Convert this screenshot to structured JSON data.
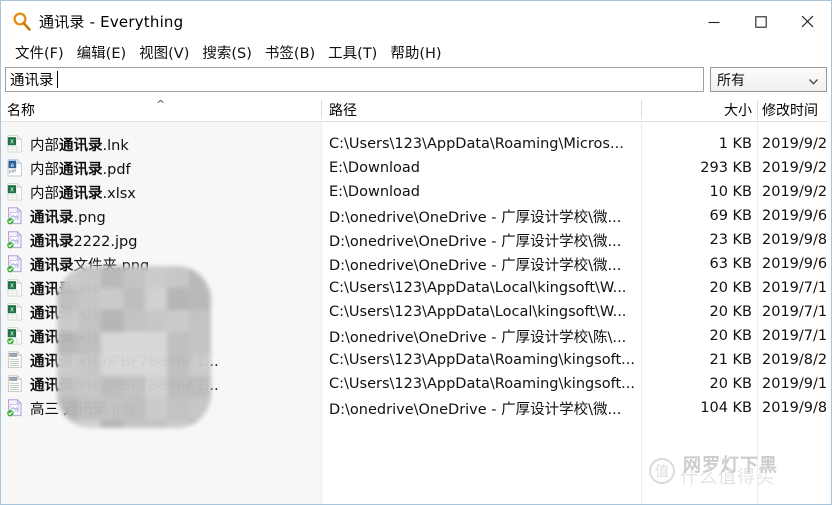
{
  "window": {
    "title": "通讯录 - Everything",
    "app_icon": "magnifier-icon",
    "controls": {
      "minimize": "—",
      "maximize": "□",
      "close": "✕"
    }
  },
  "menubar": {
    "items": [
      {
        "label": "文件(F)",
        "text": "文件(",
        "accel": "F",
        "tail": ")"
      },
      {
        "label": "编辑(E)",
        "text": "编辑(",
        "accel": "E",
        "tail": ")"
      },
      {
        "label": "视图(V)",
        "text": "视图(",
        "accel": "V",
        "tail": ")"
      },
      {
        "label": "搜索(S)",
        "text": "搜索(",
        "accel": "S",
        "tail": ")"
      },
      {
        "label": "书签(B)",
        "text": "书签(",
        "accel": "B",
        "tail": ")"
      },
      {
        "label": "工具(T)",
        "text": "工具(",
        "accel": "T",
        "tail": ")"
      },
      {
        "label": "帮助(H)",
        "text": "帮助(",
        "accel": "H",
        "tail": ")"
      }
    ]
  },
  "search": {
    "value": "通讯录",
    "placeholder": "",
    "filter_selected": "所有",
    "filter_icon": "chevron-down-icon"
  },
  "columns": [
    {
      "key": "name",
      "label": "名称",
      "sort": "asc",
      "sort_icon": "sort-ascending-icon"
    },
    {
      "key": "path",
      "label": "路径"
    },
    {
      "key": "size",
      "label": "大小"
    },
    {
      "key": "date",
      "label": "修改时间"
    }
  ],
  "rows": [
    {
      "icon": "excel-file-icon",
      "sync": false,
      "name_pre": "内部",
      "name_match": "通讯录",
      "name_post": ".lnk",
      "path": "C:\\Users\\123\\AppData\\Roaming\\Micros...",
      "size": "1 KB",
      "date": "2019/9/2"
    },
    {
      "icon": "pdf-file-icon",
      "sync": false,
      "name_pre": "内部",
      "name_match": "通讯录",
      "name_post": ".pdf",
      "path": "E:\\Download",
      "size": "293 KB",
      "date": "2019/9/2"
    },
    {
      "icon": "excel-file-icon",
      "sync": false,
      "name_pre": "内部",
      "name_match": "通讯录",
      "name_post": ".xlsx",
      "path": "E:\\Download",
      "size": "10 KB",
      "date": "2019/9/2"
    },
    {
      "icon": "image-file-icon",
      "sync": true,
      "name_pre": "",
      "name_match": "通讯录",
      "name_post": ".png",
      "path": "D:\\onedrive\\OneDrive - 广厚设计学校\\微...",
      "size": "69 KB",
      "date": "2019/9/6"
    },
    {
      "icon": "image-file-icon",
      "sync": true,
      "name_pre": "",
      "name_match": "通讯录",
      "name_post": "2222.jpg",
      "path": "D:\\onedrive\\OneDrive - 广厚设计学校\\微...",
      "size": "23 KB",
      "date": "2019/9/8"
    },
    {
      "icon": "image-file-icon",
      "sync": true,
      "name_pre": "",
      "name_match": "通讯录",
      "name_post": "文件夹.png",
      "path": "D:\\onedrive\\OneDrive - 广厚设计学校\\微...",
      "size": "63 KB",
      "date": "2019/9/6"
    },
    {
      "icon": "excel-file-icon",
      "sync": false,
      "name_pre": "",
      "name_match": "通讯录",
      "name_post": ".xls",
      "path": "C:\\Users\\123\\AppData\\Local\\kingsoft\\W...",
      "size": "20 KB",
      "date": "2019/7/1"
    },
    {
      "icon": "excel-file-icon",
      "sync": false,
      "name_pre": "",
      "name_match": "通讯录",
      "name_post": ".xls",
      "path": "C:\\Users\\123\\AppData\\Local\\kingsoft\\W...",
      "size": "20 KB",
      "date": "2019/7/1"
    },
    {
      "icon": "excel-file-icon",
      "sync": true,
      "name_pre": "",
      "name_match": "通讯录",
      "name_post": ".xls",
      "path": "D:\\onedrive\\OneDrive - 广厚设计学校\\陈\\...",
      "size": "20 KB",
      "date": "2019/7/1"
    },
    {
      "icon": "backup-file-icon",
      "sync": false,
      "name_pre": "",
      "name_match": "通讯录",
      "name_post": ".xls.0FBF7B896A1...",
      "path": "C:\\Users\\123\\AppData\\Roaming\\kingsoft...",
      "size": "21 KB",
      "date": "2019/8/2"
    },
    {
      "icon": "backup-file-icon",
      "sync": false,
      "name_pre": "",
      "name_match": "通讯录",
      "name_post": ".xls.0FBF7B896A1...",
      "path": "C:\\Users\\123\\AppData\\Roaming\\kingsoft...",
      "size": "20 KB",
      "date": "2019/9/1"
    },
    {
      "icon": "image-file-icon",
      "sync": true,
      "name_pre": "高三 ",
      "name_match": "通讯录",
      "name_post": ".jpg",
      "path": "D:\\onedrive\\OneDrive - 广厚设计学校\\微...",
      "size": "104 KB",
      "date": "2019/9/8"
    }
  ],
  "redaction": {
    "type": "mosaic-blur-overlay",
    "note": ""
  },
  "watermark": {
    "badge": "值",
    "main_text": "什么值得买",
    "overlay_text": "网罗灯下黑"
  },
  "colors": {
    "window_border": "#a8c4d8",
    "excel_green": "#1e7145",
    "pdf_blue": "#2a6099",
    "image_purple": "#b39ddb",
    "sync_green": "#3bab3b",
    "accent_orange": "#e8890c"
  }
}
